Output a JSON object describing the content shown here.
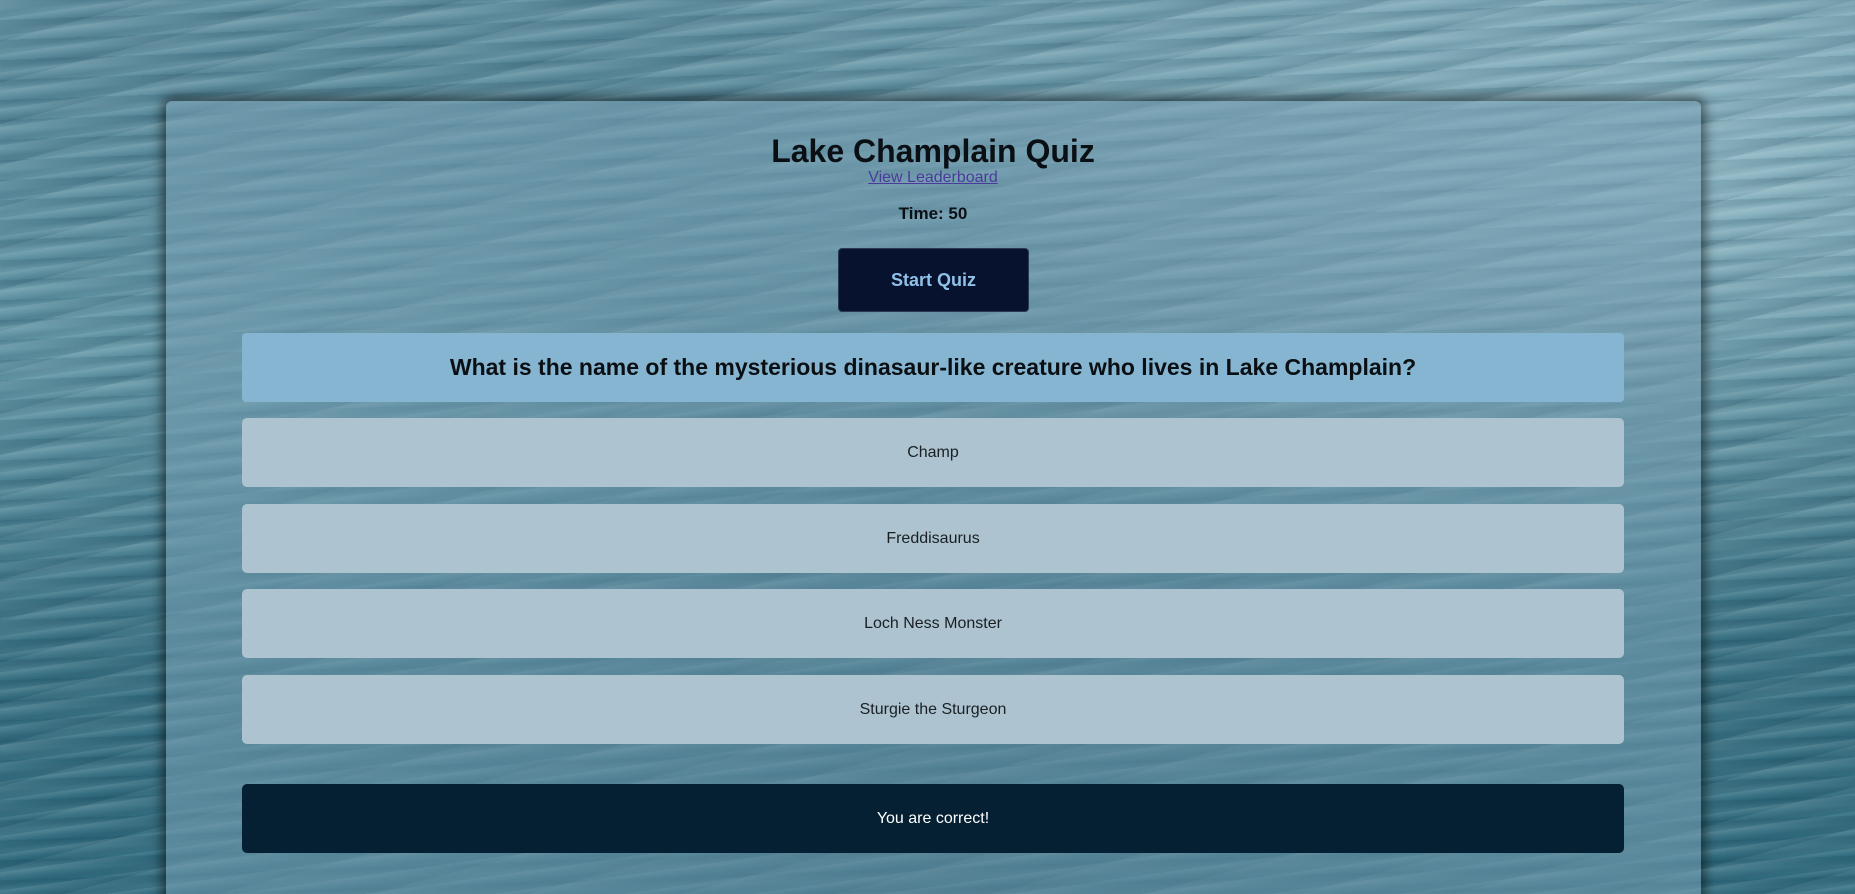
{
  "quiz": {
    "title": "Lake Champlain Quiz",
    "leaderboard_link": "View Leaderboard",
    "timer_text": "Time: 50",
    "start_button": "Start Quiz"
  },
  "question": {
    "text": "What is the name of the mysterious dinasaur-like creature who lives in Lake Champlain?",
    "answers": [
      "Champ",
      "Freddisaurus",
      "Loch Ness Monster",
      "Sturgie the Sturgeon"
    ]
  },
  "feedback": {
    "text": "You are correct!"
  },
  "colors": {
    "start_button_bg": "#07122e",
    "start_button_text": "#8fc0e8",
    "question_bg": "#86b5d1",
    "answer_bg": "#adc4d0",
    "feedback_bg": "#051f33",
    "link": "#4a3b9a"
  }
}
